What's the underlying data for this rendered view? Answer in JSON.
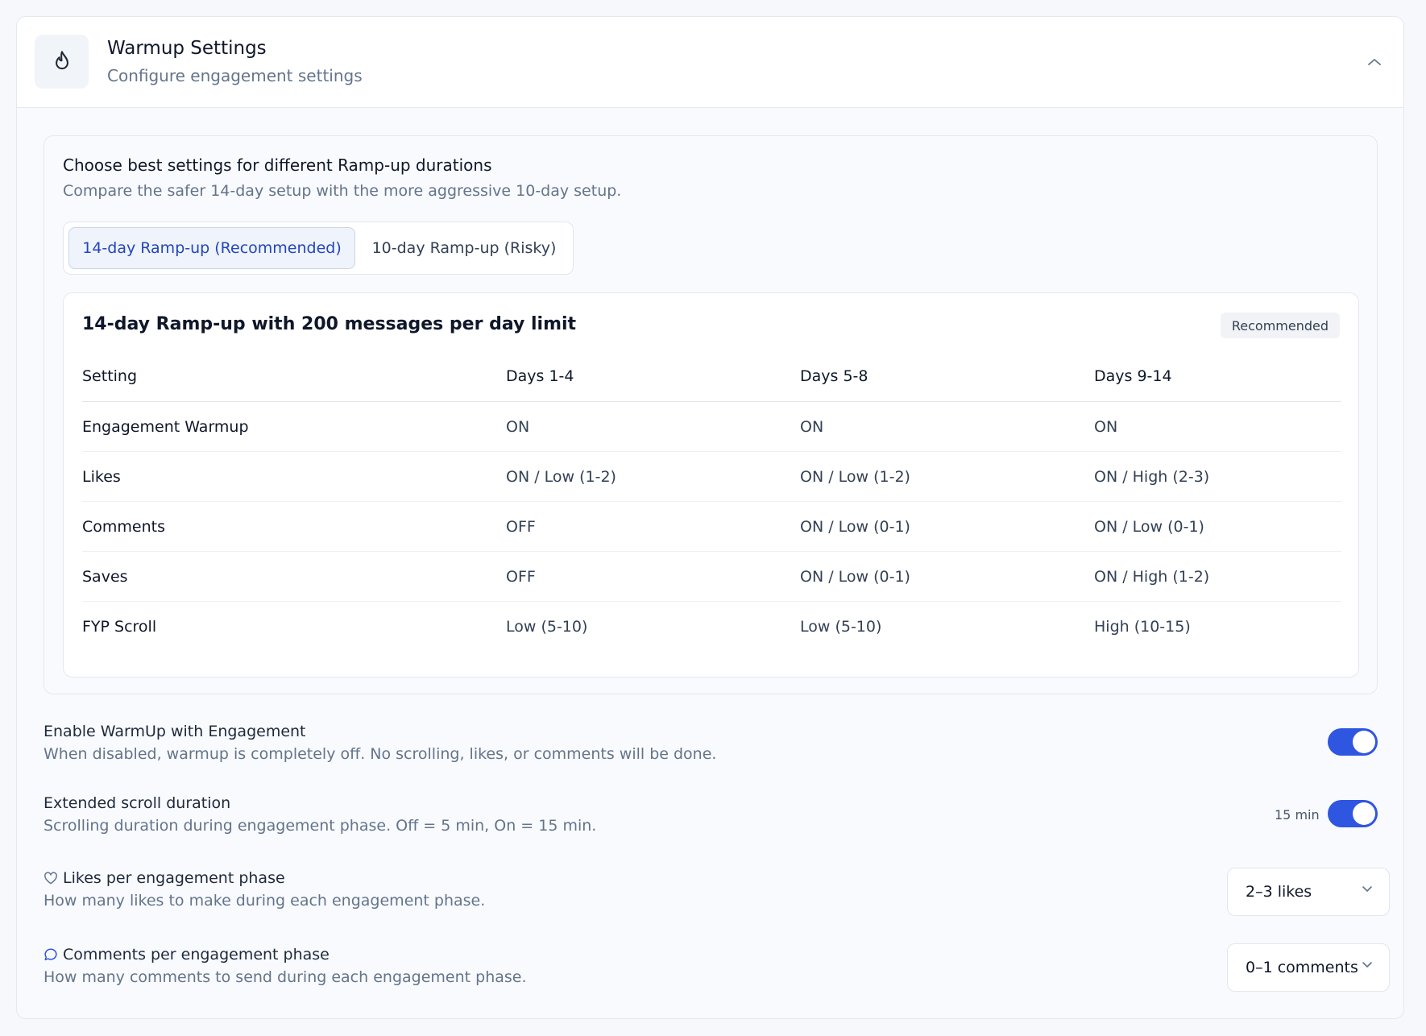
{
  "header": {
    "icon": "flame-icon",
    "title": "Warmup Settings",
    "subtitle": "Configure engagement settings",
    "collapse_icon": "chevron-up-icon"
  },
  "ramp": {
    "title": "Choose best settings for different Ramp-up durations",
    "subtitle": "Compare the safer 14-day setup with the more aggressive 10-day setup.",
    "tabs": [
      {
        "label": "14-day Ramp-up (Recommended)",
        "active": true
      },
      {
        "label": "10-day Ramp-up (Risky)",
        "active": false
      }
    ],
    "table": {
      "title": "14-day Ramp-up with 200 messages per day limit",
      "badge": "Recommended",
      "columns": [
        "Setting",
        "Days 1-4",
        "Days 5-8",
        "Days 9-14"
      ],
      "rows": [
        [
          "Engagement Warmup",
          "ON",
          "ON",
          "ON"
        ],
        [
          "Likes",
          "ON / Low (1-2)",
          "ON / Low (1-2)",
          "ON / High (2-3)"
        ],
        [
          "Comments",
          "OFF",
          "ON / Low (0-1)",
          "ON / Low (0-1)"
        ],
        [
          "Saves",
          "OFF",
          "ON / Low (0-1)",
          "ON / High (1-2)"
        ],
        [
          "FYP Scroll",
          "Low (5-10)",
          "Low (5-10)",
          "High (10-15)"
        ]
      ]
    }
  },
  "settings": {
    "enable_warmup": {
      "title": "Enable WarmUp with Engagement",
      "description": "When disabled, warmup is completely off. No scrolling, likes, or comments will be done.",
      "enabled": true
    },
    "extended_scroll": {
      "title": "Extended scroll duration",
      "description": "Scrolling duration during engagement phase. Off = 5 min, On = 15 min.",
      "value_label": "15 min",
      "enabled": true
    },
    "likes_per_phase": {
      "icon": "heart-icon",
      "title": "Likes per engagement phase",
      "description": "How many likes to make during each engagement phase.",
      "selected": "2–3 likes"
    },
    "comments_per_phase": {
      "icon": "comment-icon",
      "title": "Comments per engagement phase",
      "description": "How many comments to send during each engagement phase.",
      "selected": "0–1 comments"
    }
  },
  "colors": {
    "accent": "#2f56e0",
    "tab_active_text": "#2446b8",
    "muted_text": "#64748b"
  }
}
